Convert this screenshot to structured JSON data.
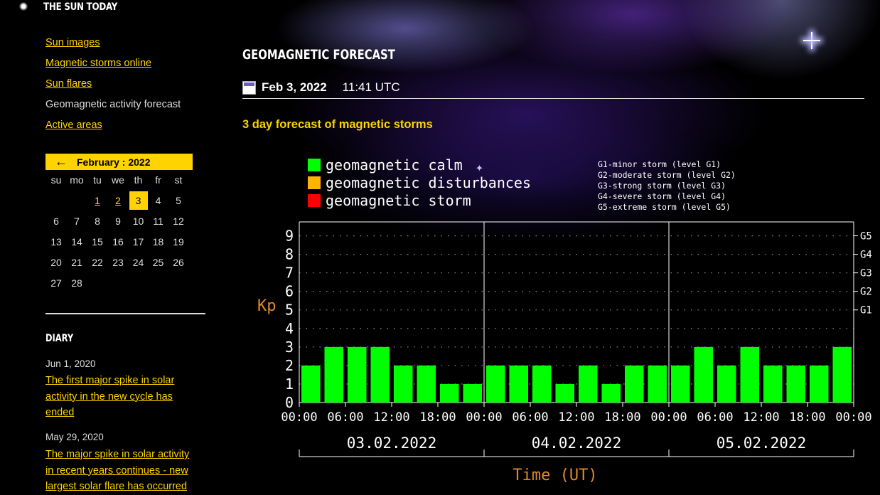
{
  "site": {
    "title": "THE SUN TODAY"
  },
  "nav": {
    "items": [
      {
        "label": "Sun images",
        "link": true
      },
      {
        "label": "Magnetic storms online",
        "link": true
      },
      {
        "label": "Sun flares",
        "link": true
      },
      {
        "label": "Geomagnetic activity forecast",
        "link": false
      },
      {
        "label": "Active areas",
        "link": true
      }
    ]
  },
  "calendar": {
    "prev_arrow": "←",
    "month_label": "February : 2022",
    "weekdays": [
      "su",
      "mo",
      "tu",
      "we",
      "th",
      "fr",
      "st"
    ],
    "weeks": [
      [
        "",
        "",
        "1",
        "2",
        "3",
        "4",
        "5"
      ],
      [
        "6",
        "7",
        "8",
        "9",
        "10",
        "11",
        "12"
      ],
      [
        "13",
        "14",
        "15",
        "16",
        "17",
        "18",
        "19"
      ],
      [
        "20",
        "21",
        "22",
        "23",
        "24",
        "25",
        "26"
      ],
      [
        "27",
        "28",
        "",
        "",
        "",
        "",
        ""
      ]
    ],
    "linked_days": [
      "1",
      "2"
    ],
    "today": "3"
  },
  "diary": {
    "title": "DIARY",
    "entries": [
      {
        "date": "Jun 1, 2020",
        "title": "The first major spike in solar activity in the new cycle has ended"
      },
      {
        "date": "May 29, 2020",
        "title": "The major spike in solar activity in recent years continues - new largest solar flare has occurred"
      }
    ]
  },
  "main": {
    "title": "GEOMAGNETIC FORECAST",
    "date": "Feb 3, 2022",
    "time": "11:41 UTC",
    "subtitle": "3 day forecast of magnetic storms"
  },
  "colors": {
    "accent": "#ffd300",
    "calm": "#00ff00",
    "disturbances": "#ffb400",
    "storm": "#ff0000",
    "axis_label": "#e08a1e"
  },
  "chart_data": {
    "type": "bar",
    "legend": [
      {
        "label": "geomagnetic calm",
        "color": "#00ff00"
      },
      {
        "label": "geomagnetic disturbances",
        "color": "#ffb400"
      },
      {
        "label": "geomagnetic storm",
        "color": "#ff0000"
      }
    ],
    "storm_levels": [
      "G1-minor storm (level G1)",
      "G2-moderate storm (level G2)",
      "G3-strong storm (level G3)",
      "G4-severe storm (level G4)",
      "G5-extreme storm (level G5)"
    ],
    "ylabel": "Kp",
    "xlabel": "Time (UT)",
    "ylim": [
      0,
      9
    ],
    "yticks": [
      0,
      1,
      2,
      3,
      4,
      5,
      6,
      7,
      8,
      9
    ],
    "right_labels": [
      {
        "kp": 5,
        "label": "G1"
      },
      {
        "kp": 6,
        "label": "G2"
      },
      {
        "kp": 7,
        "label": "G3"
      },
      {
        "kp": 8,
        "label": "G4"
      },
      {
        "kp": 9,
        "label": "G5"
      }
    ],
    "days": [
      "03.02.2022",
      "04.02.2022",
      "05.02.2022"
    ],
    "time_ticks": [
      "00:00",
      "06:00",
      "12:00",
      "18:00",
      "00:00",
      "06:00",
      "12:00",
      "18:00",
      "00:00",
      "06:00",
      "12:00",
      "18:00",
      "00:00"
    ],
    "grid": "dotted",
    "values": [
      2,
      3,
      3,
      3,
      2,
      2,
      1,
      1,
      2,
      2,
      2,
      1,
      2,
      1,
      2,
      2,
      2,
      3,
      2,
      3,
      2,
      2,
      2,
      3
    ]
  }
}
